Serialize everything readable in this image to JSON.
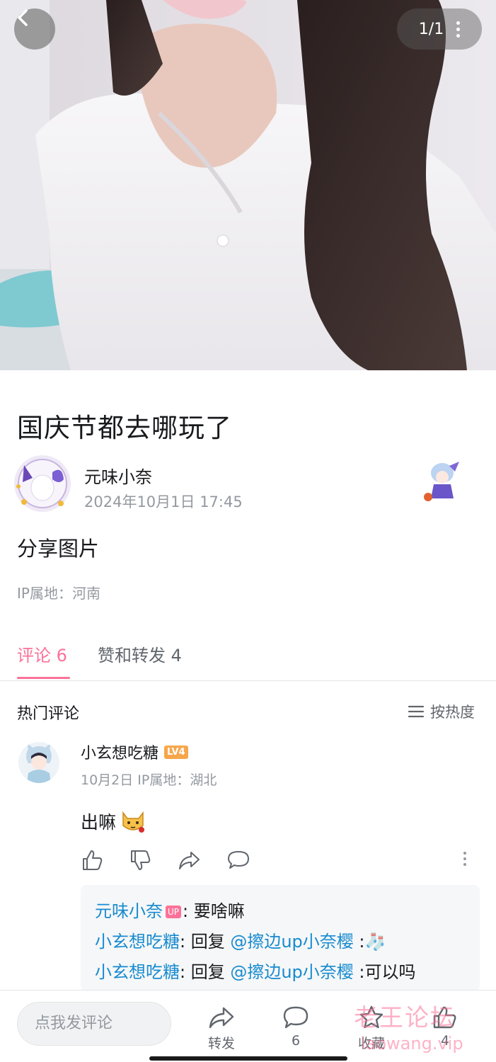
{
  "hero": {
    "pager": "1/1"
  },
  "post": {
    "title": "国庆节都去哪玩了",
    "author": "元味小奈",
    "time": "2024年10月1日 17:45",
    "body": "分享图片",
    "ip": "IP属地：河南"
  },
  "tabs": {
    "comments": "评论 6",
    "likes_reposts": "赞和转发 4"
  },
  "comments": {
    "section_title": "热门评论",
    "sort_label": "按热度",
    "items": [
      {
        "user": "小玄想吃糖",
        "level": "LV4",
        "meta": "10月2日  IP属地：湖北",
        "text": "出嘛",
        "replies": [
          {
            "user": "元味小奈",
            "tag": "UP",
            "text": ": 要啥嘛"
          },
          {
            "user": "小玄想吃糖",
            "prefix": ": 回复 ",
            "mention": "@擦边up小奈樱",
            "text": " :🧦"
          },
          {
            "user": "小玄想吃糖",
            "prefix": ": 回复 ",
            "mention": "@擦边up小奈樱",
            "text": " :可以吗"
          }
        ]
      }
    ]
  },
  "bottom_bar": {
    "input_placeholder": "点我发评论",
    "repost_label": "转发",
    "comment_count": "6",
    "favorite_label": "收藏",
    "like_count": "4"
  },
  "watermark": {
    "line1": "老王论坛",
    "line2": "laowang.vip"
  },
  "colors": {
    "accent": "#fb7299",
    "link": "#178bcf",
    "muted": "#9499a0"
  },
  "icons": [
    "back-arrow-icon",
    "more-vertical-icon",
    "menu-lines-icon",
    "thumb-up-icon",
    "thumb-down-icon",
    "share-icon",
    "comment-icon",
    "star-icon"
  ]
}
